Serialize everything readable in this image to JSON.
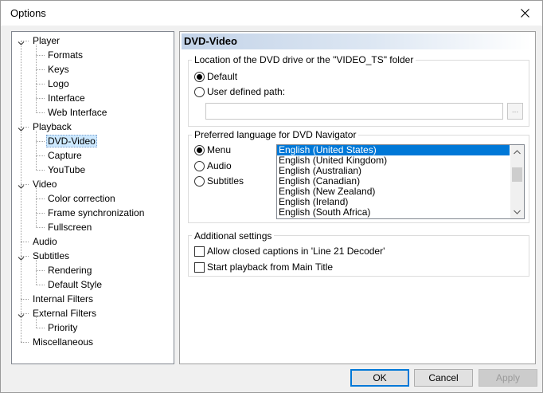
{
  "window": {
    "title": "Options"
  },
  "tree": {
    "items": [
      {
        "label": "Player",
        "level": 0,
        "expanded": true
      },
      {
        "label": "Formats",
        "level": 1
      },
      {
        "label": "Keys",
        "level": 1
      },
      {
        "label": "Logo",
        "level": 1
      },
      {
        "label": "Interface",
        "level": 1
      },
      {
        "label": "Web Interface",
        "level": 1
      },
      {
        "label": "Playback",
        "level": 0,
        "expanded": true
      },
      {
        "label": "DVD-Video",
        "level": 1,
        "selected": true
      },
      {
        "label": "Capture",
        "level": 1
      },
      {
        "label": "YouTube",
        "level": 1
      },
      {
        "label": "Video",
        "level": 0,
        "expanded": true
      },
      {
        "label": "Color correction",
        "level": 1
      },
      {
        "label": "Frame synchronization",
        "level": 1
      },
      {
        "label": "Fullscreen",
        "level": 1
      },
      {
        "label": "Audio",
        "level": 0
      },
      {
        "label": "Subtitles",
        "level": 0,
        "expanded": true
      },
      {
        "label": "Rendering",
        "level": 1
      },
      {
        "label": "Default Style",
        "level": 1
      },
      {
        "label": "Internal Filters",
        "level": 0
      },
      {
        "label": "External Filters",
        "level": 0,
        "expanded": true
      },
      {
        "label": "Priority",
        "level": 1
      },
      {
        "label": "Miscellaneous",
        "level": 0
      }
    ]
  },
  "panel": {
    "header": "DVD-Video",
    "location": {
      "label": "Location of the DVD drive or the \"VIDEO_TS\" folder",
      "default_label": "Default",
      "user_defined_label": "User defined path:",
      "path_value": "",
      "browse_label": "..."
    },
    "language": {
      "label": "Preferred language for DVD Navigator",
      "menu_label": "Menu",
      "audio_label": "Audio",
      "subtitles_label": "Subtitles",
      "languages": [
        "English (United States)",
        "English (United Kingdom)",
        "English (Australian)",
        "English (Canadian)",
        "English (New Zealand)",
        "English (Ireland)",
        "English (South Africa)"
      ]
    },
    "additional": {
      "label": "Additional settings",
      "closed_captions_label": "Allow closed captions in 'Line 21 Decoder'",
      "start_main_title_label": "Start playback from Main Title"
    }
  },
  "buttons": {
    "ok": "OK",
    "cancel": "Cancel",
    "apply": "Apply"
  },
  "colors": {
    "selection": "#0078d7",
    "tree_selection": "#cce8ff",
    "header_gradient": "#c3d3e8"
  }
}
